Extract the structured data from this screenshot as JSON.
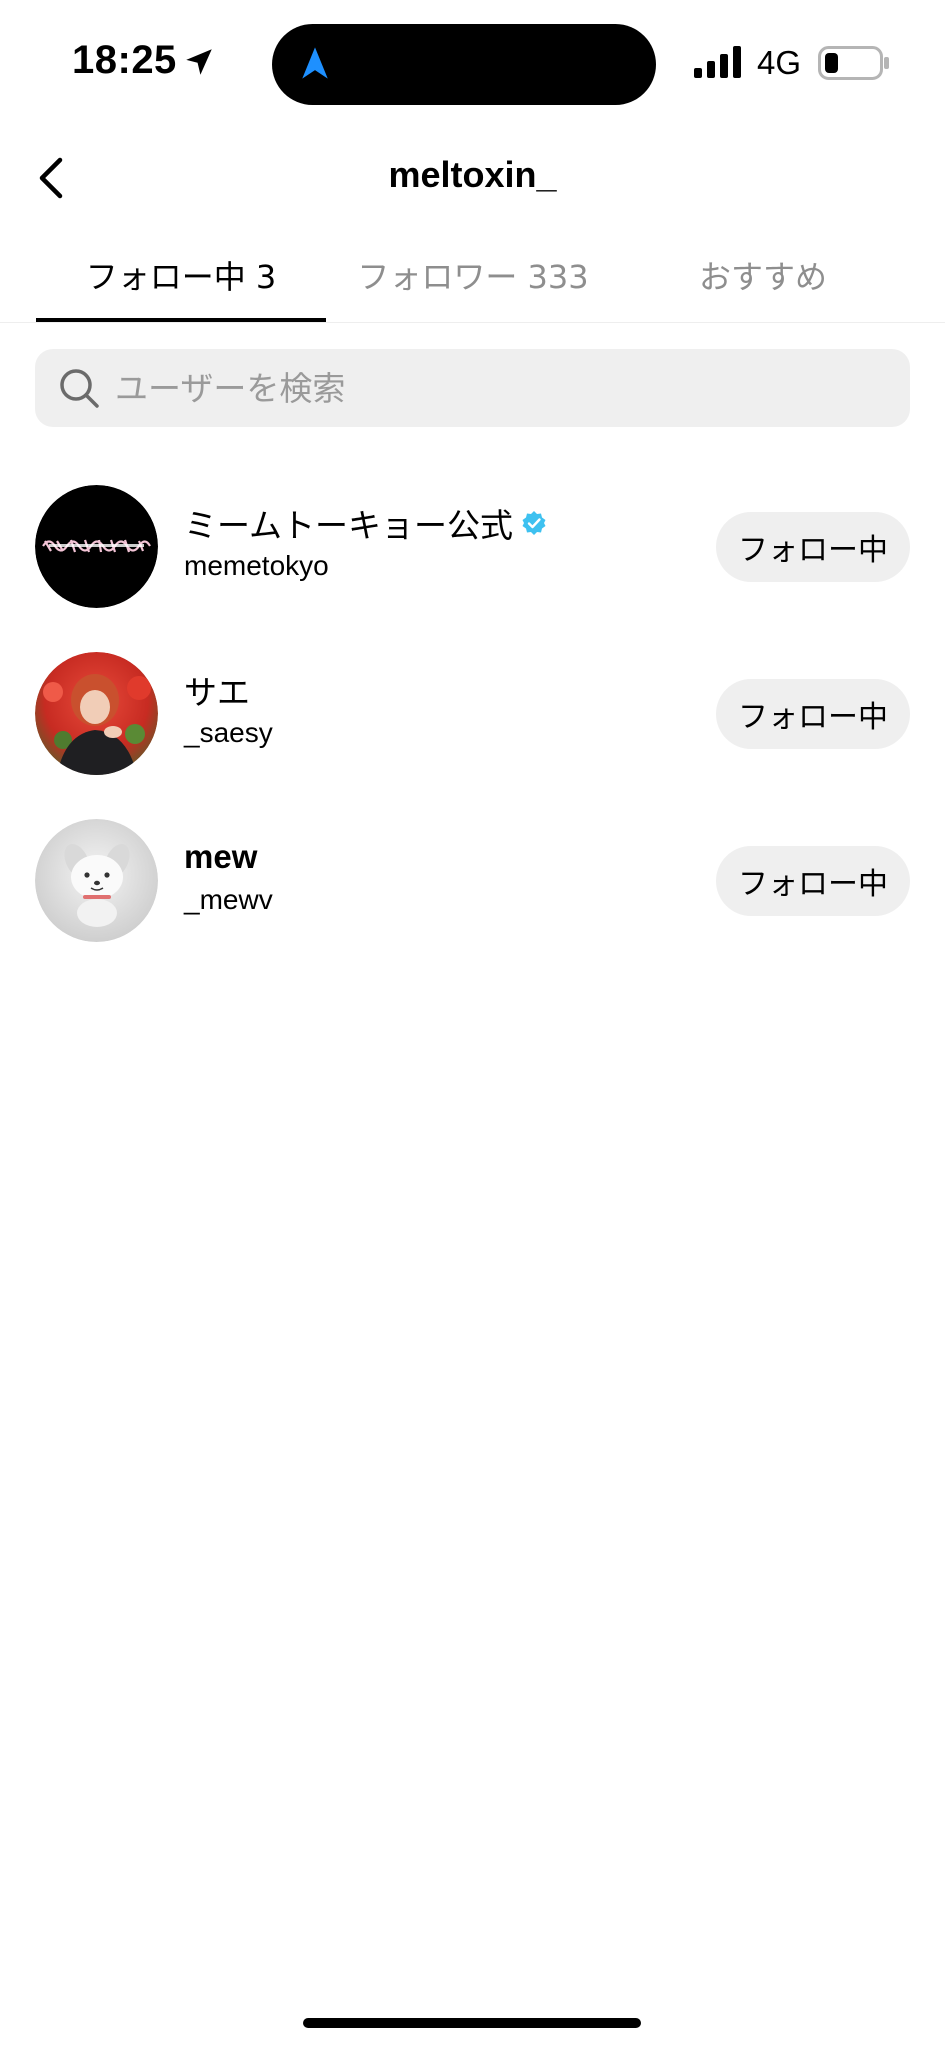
{
  "status_bar": {
    "time": "18:25",
    "network": "4G"
  },
  "header": {
    "title": "meltoxin_"
  },
  "tabs": [
    {
      "label": "フォロー中 3"
    },
    {
      "label": "フォロワー 333"
    },
    {
      "label": "おすすめ"
    }
  ],
  "search": {
    "placeholder": "ユーザーを検索",
    "value": ""
  },
  "users": [
    {
      "name": "ミームトーキョー公式",
      "handle": "memetokyo",
      "verified": true,
      "button_label": "フォロー中"
    },
    {
      "name": "サエ",
      "handle": "_saesy",
      "verified": false,
      "button_label": "フォロー中"
    },
    {
      "name": "mew",
      "handle": "_mewv",
      "verified": false,
      "button_label": "フォロー中"
    }
  ],
  "colors": {
    "verified": "#3897f0",
    "accent_nav": "#1e90ff",
    "button_bg": "#efefef",
    "muted_text": "#8e8e8e"
  }
}
